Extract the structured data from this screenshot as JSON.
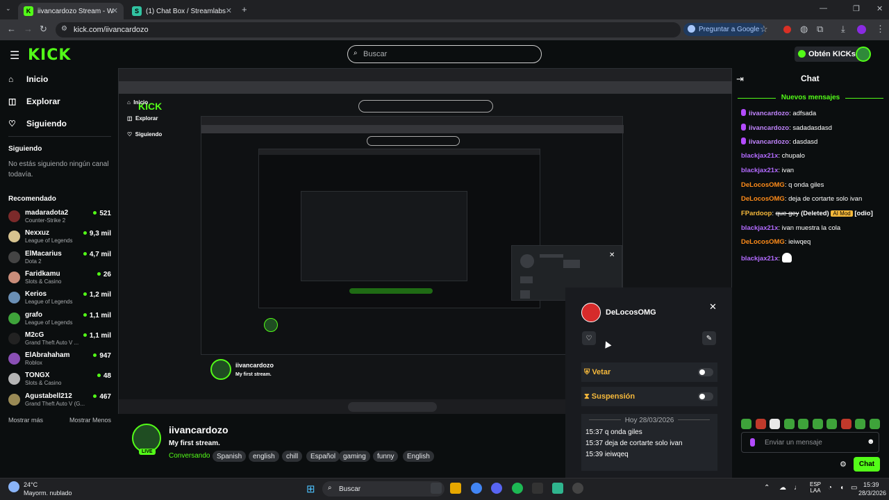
{
  "browser": {
    "tabs": [
      {
        "title": "iivancardozo Stream - Watch Li"
      },
      {
        "title": "(1) Chat Box / Streamlabs"
      }
    ],
    "url": "kick.com/iivancardozo",
    "google_pill": "Preguntar a Google"
  },
  "header": {
    "logo": "KICK",
    "search_placeholder": "Buscar",
    "kicks_button": "Obtén KICKs"
  },
  "sidebar": {
    "nav": [
      {
        "label": "Inicio",
        "icon": "home-icon"
      },
      {
        "label": "Explorar",
        "icon": "compass-icon"
      },
      {
        "label": "Siguiendo",
        "icon": "heart-icon"
      }
    ],
    "following_title": "Siguiendo",
    "following_empty": "No estás siguiendo ningún canal todavía.",
    "recommended_title": "Recomendado",
    "recommended": [
      {
        "name": "madaradota2",
        "category": "Counter-Strike 2",
        "viewers": "521",
        "color": "#7b2a2a"
      },
      {
        "name": "Nexxuz",
        "category": "League of Legends",
        "viewers": "9,3 mil",
        "color": "#d7c38f"
      },
      {
        "name": "ElMacarius",
        "category": "Dota 2",
        "viewers": "4,7 mil",
        "color": "#444"
      },
      {
        "name": "Faridkamu",
        "category": "Slots & Casino",
        "viewers": "26",
        "color": "#c98d7a"
      },
      {
        "name": "Kerios",
        "category": "League of Legends",
        "viewers": "1,2 mil",
        "color": "#6a8fb5"
      },
      {
        "name": "grafo",
        "category": "League of Legends",
        "viewers": "1,1 mil",
        "color": "#3ea33a"
      },
      {
        "name": "M2cG",
        "category": "Grand Theft Auto V ...",
        "viewers": "1,1 mil",
        "color": "#222"
      },
      {
        "name": "ElAbrahaham",
        "category": "Roblox",
        "viewers": "947",
        "color": "#8a4fb5"
      },
      {
        "name": "TONGX",
        "category": "Slots & Casino",
        "viewers": "48",
        "color": "#b5b5b5"
      },
      {
        "name": "Agustabell212",
        "category": "Grand Theft Auto V (G...",
        "viewers": "467",
        "color": "#9a8a55"
      }
    ],
    "show_more": "Mostrar más",
    "show_less": "Mostrar Menos"
  },
  "channel": {
    "name": "iivancardozo",
    "live": "LIVE",
    "title": "My first stream.",
    "category": "Conversando",
    "tags": [
      "Spanish",
      "english",
      "chill",
      "Español",
      "gaming",
      "funny",
      "English"
    ]
  },
  "mod_panel": {
    "username": "DeLocosOMG",
    "ban_label": "Vetar",
    "timeout_label": "Suspensión",
    "date": "Hoy 28/03/2026",
    "history": [
      {
        "time": "15:37",
        "text": "q onda giles"
      },
      {
        "time": "15:37",
        "text": "deja de cortarte solo ivan"
      },
      {
        "time": "15:39",
        "text": "ieiwqeq"
      }
    ]
  },
  "chat": {
    "title": "Chat",
    "new_messages": "Nuevos mensajes",
    "messages": [
      {
        "user": "iivancardozo",
        "text": "adfsada",
        "color": "#c084fc",
        "mic": true
      },
      {
        "user": "iivancardozo",
        "text": "sadadasdasd",
        "color": "#c084fc",
        "mic": true
      },
      {
        "user": "iivancardozo",
        "text": "dasdasd",
        "color": "#c084fc",
        "mic": true
      },
      {
        "user": "blackjax21x",
        "text": "chupalo",
        "color": "#b36bff"
      },
      {
        "user": "blackjax21x",
        "text": "ivan",
        "color": "#b36bff"
      },
      {
        "user": "DeLocosOMG",
        "text": "q onda giles",
        "color": "#ff8c1a"
      },
      {
        "user": "DeLocosOMG",
        "text": "deja de cortarte solo ivan",
        "color": "#ff8c1a"
      },
      {
        "user": "FPardoop",
        "text": "que gey",
        "color": "#f6b93b",
        "deleted": "(Deleted)",
        "mod": "AI Mod",
        "extra": "[odio]"
      },
      {
        "user": "blackjax21x",
        "text": "ivan muestra la cola",
        "color": "#b36bff"
      },
      {
        "user": "DeLocosOMG",
        "text": "ieiwqeq",
        "color": "#ff8c1a"
      },
      {
        "user": "blackjax21x",
        "text": "",
        "color": "#b36bff"
      }
    ],
    "input_placeholder": "Enviar un mensaje",
    "send": "Chat"
  },
  "taskbar": {
    "temp": "24°C",
    "weather": "Mayorm. nublado",
    "search": "Buscar",
    "lang": "ESP",
    "lang2": "LAA",
    "time": "15:39",
    "date": "28/3/2026"
  }
}
